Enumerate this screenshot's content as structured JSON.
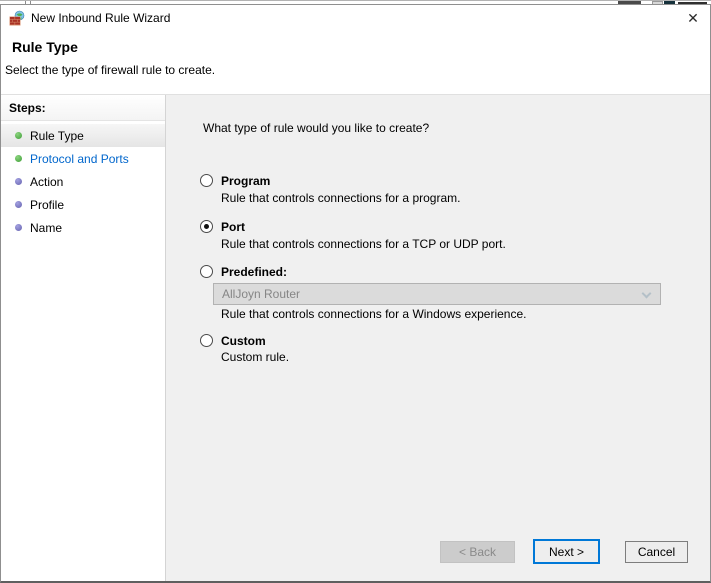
{
  "window": {
    "title": "New Inbound Rule Wizard",
    "icon": "firewall-brick-globe-icon",
    "close_glyph": "✕"
  },
  "header": {
    "title": "Rule Type",
    "subtitle": "Select the type of firewall rule to create."
  },
  "sidebar": {
    "title": "Steps:",
    "items": [
      {
        "label": "Rule Type",
        "bullet": "green",
        "state": "current"
      },
      {
        "label": "Protocol and Ports",
        "bullet": "green",
        "state": "link"
      },
      {
        "label": "Action",
        "bullet": "purple",
        "state": "upcoming"
      },
      {
        "label": "Profile",
        "bullet": "purple",
        "state": "upcoming"
      },
      {
        "label": "Name",
        "bullet": "purple",
        "state": "upcoming"
      }
    ]
  },
  "main": {
    "question": "What type of rule would you like to create?",
    "options": [
      {
        "label": "Program",
        "description": "Rule that controls connections for a program.",
        "selected": false
      },
      {
        "label": "Port",
        "description": "Rule that controls connections for a TCP or UDP port.",
        "selected": true
      },
      {
        "label": "Predefined:",
        "description": "Rule that controls connections for a Windows experience.",
        "selected": false,
        "dropdown": {
          "value": "AllJoyn Router",
          "disabled": true
        }
      },
      {
        "label": "Custom",
        "description": "Custom rule.",
        "selected": false
      }
    ]
  },
  "footer": {
    "back": {
      "label": "< Back",
      "enabled": false
    },
    "next": {
      "label": "Next >",
      "enabled": true,
      "focused": true
    },
    "cancel": {
      "label": "Cancel",
      "enabled": true
    }
  },
  "colors": {
    "accent_focus_border": "#0078d7",
    "step_link_blue": "#0066cc",
    "bullet_green": "#3f9e38",
    "bullet_purple": "#6663b0",
    "content_background": "#f0f0f0",
    "disabled_combo_background": "#dbdbdb"
  }
}
